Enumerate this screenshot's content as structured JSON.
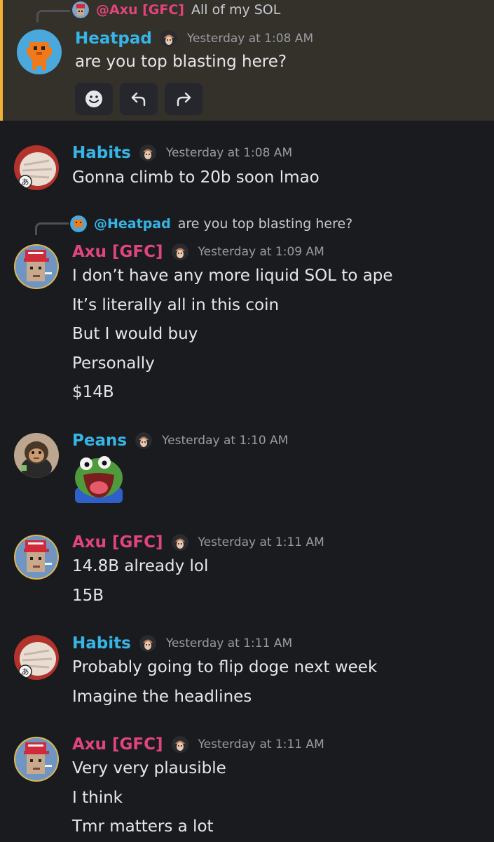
{
  "colors": {
    "background": "#1a1b1f",
    "highlight_bg": "#34302a",
    "highlight_bar": "#f0b232",
    "name_blue": "#36b6e6",
    "name_pink": "#e0457b",
    "timestamp": "#9a9ca3"
  },
  "messages": [
    {
      "reply": {
        "mention": "@Axu [GFC]",
        "text": "All of my SOL"
      },
      "author": "Heatpad",
      "timestamp": "Yesterday at 1:08 AM",
      "lines": [
        "are you top blasting here?"
      ],
      "actions": [
        "smile-icon",
        "reply-icon",
        "forward-icon"
      ]
    },
    {
      "author": "Habits",
      "timestamp": "Yesterday at 1:08 AM",
      "lines": [
        "Gonna climb to 20b soon lmao"
      ]
    },
    {
      "reply": {
        "mention": "@Heatpad",
        "text": "are you top blasting here?"
      },
      "author": "Axu [GFC]",
      "timestamp": "Yesterday at 1:09 AM",
      "lines": [
        "I don’t have any more liquid SOL to ape",
        "It’s literally all in this coin",
        "But I would buy",
        "Personally",
        "$14B"
      ]
    },
    {
      "author": "Peans",
      "timestamp": "Yesterday at 1:10 AM",
      "sticker": "pepe-emote"
    },
    {
      "author": "Axu [GFC]",
      "timestamp": "Yesterday at 1:11 AM",
      "lines": [
        "14.8B already lol",
        "15B"
      ]
    },
    {
      "author": "Habits",
      "timestamp": "Yesterday at 1:11 AM",
      "lines": [
        "Probably going to flip doge next week",
        "Imagine the headlines"
      ]
    },
    {
      "author": "Axu [GFC]",
      "timestamp": "Yesterday at 1:11 AM",
      "lines": [
        "Very very plausible",
        "I think",
        "Tmr matters a lot"
      ]
    }
  ]
}
